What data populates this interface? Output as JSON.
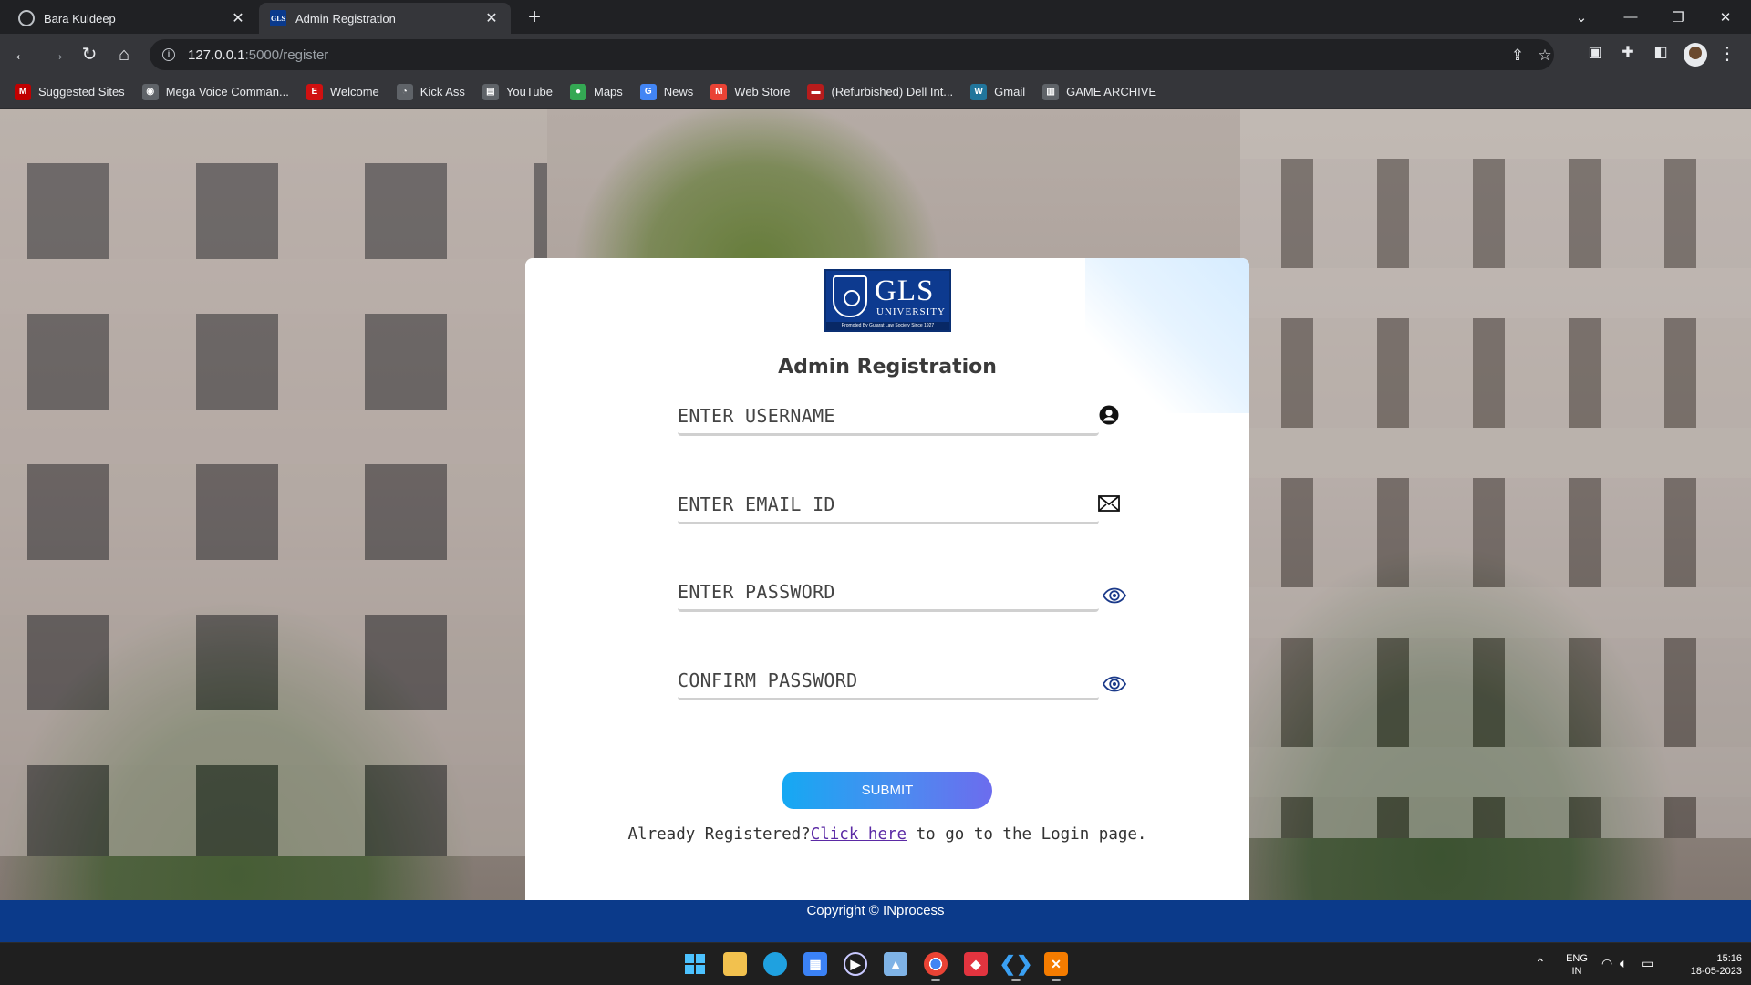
{
  "browser": {
    "tabs": [
      {
        "title": "Bara Kuldeep",
        "icon": "globe-icon",
        "active": false
      },
      {
        "title": "Admin Registration",
        "icon": "gls-favicon",
        "active": true
      }
    ],
    "url_host": "127.0.0.1",
    "url_path": ":5000/register",
    "bookmarks": [
      {
        "label": "Suggested Sites",
        "icon": "suggested-sites-icon",
        "color": "#c00000",
        "glyph": "M"
      },
      {
        "label": "Mega Voice Comman...",
        "icon": "voice-icon",
        "color": "#5f6368",
        "glyph": "◉"
      },
      {
        "label": "Welcome",
        "icon": "welcome-icon",
        "color": "#d01010",
        "glyph": "E"
      },
      {
        "label": "Kick Ass",
        "icon": "kickass-icon",
        "color": "#5f6368",
        "glyph": "◔"
      },
      {
        "label": "YouTube",
        "icon": "youtube-icon",
        "color": "#5f6368",
        "glyph": "▤"
      },
      {
        "label": "Maps",
        "icon": "maps-icon",
        "color": "#34a853",
        "glyph": "●"
      },
      {
        "label": "News",
        "icon": "news-icon",
        "color": "#4285f4",
        "glyph": "G"
      },
      {
        "label": "Web Store",
        "icon": "gmail-store-icon",
        "color": "#ea4335",
        "glyph": "M"
      },
      {
        "label": "(Refurbished) Dell Int...",
        "icon": "car-icon",
        "color": "#b71c1c",
        "glyph": "▬"
      },
      {
        "label": "Gmail",
        "icon": "wordpress-icon",
        "color": "#21759b",
        "glyph": "W"
      },
      {
        "label": "GAME ARCHIVE",
        "icon": "archive-icon",
        "color": "#5f6368",
        "glyph": "▥"
      }
    ]
  },
  "form": {
    "logo_text": "GLS",
    "logo_subtext": "UNIVERSITY",
    "logo_tagline": "Promoted By Gujarat Law Society Since 1927",
    "title": "Admin Registration",
    "username_placeholder": "ENTER USERNAME",
    "email_placeholder": "ENTER EMAIL ID",
    "password_placeholder": "ENTER PASSWORD",
    "confirm_placeholder": "CONFIRM PASSWORD",
    "submit_label": "SUBMIT",
    "already_text": "Already Registered?",
    "login_link": "Click here",
    "after_link": " to go to the Login page."
  },
  "footer": {
    "copyright": "Copyright © INprocess"
  },
  "taskbar": {
    "language": "ENG",
    "region": "IN",
    "time": "15:16",
    "date": "18-05-2023"
  },
  "colors": {
    "card_bg": "#ffffff",
    "footer_bg": "#0b3a8a",
    "submit_gradient_start": "#15a9f3",
    "submit_gradient_end": "#6c6cee",
    "link": "#5b2aa5"
  }
}
